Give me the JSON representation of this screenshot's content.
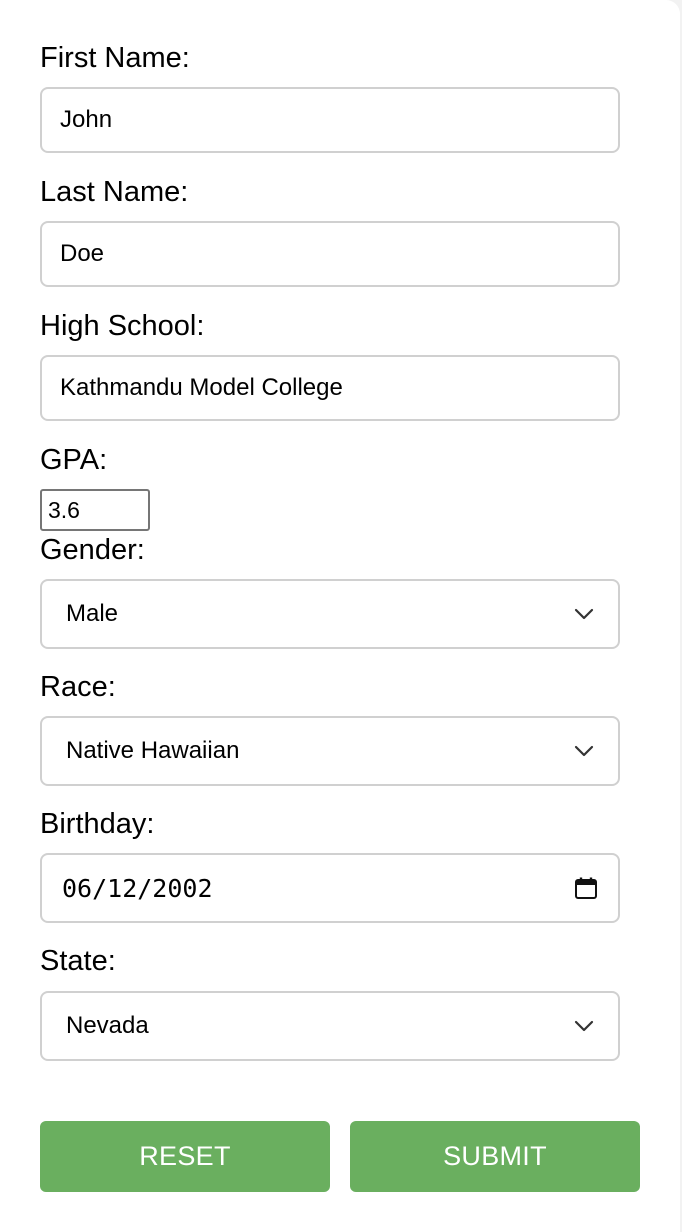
{
  "form": {
    "first_name": {
      "label": "First Name:",
      "value": "John"
    },
    "last_name": {
      "label": "Last Name:",
      "value": "Doe"
    },
    "high_school": {
      "label": "High School:",
      "value": "Kathmandu Model College"
    },
    "gpa": {
      "label": "GPA:",
      "value": "3.6"
    },
    "gender": {
      "label": "Gender:",
      "value": "Male"
    },
    "race": {
      "label": "Race:",
      "value": "Native Hawaiian"
    },
    "birthday": {
      "label": "Birthday:",
      "value": "06/12/2002"
    },
    "state": {
      "label": "State:",
      "value": "Nevada"
    }
  },
  "actions": {
    "reset_label": "RESET",
    "submit_label": "SUBMIT"
  },
  "icons": {
    "dropdown": "chevron-down-icon",
    "date_picker": "calendar-icon"
  },
  "colors": {
    "button_green": "#6aaf5f",
    "input_border": "#d0d0d0",
    "background": "#f2f2f2"
  }
}
